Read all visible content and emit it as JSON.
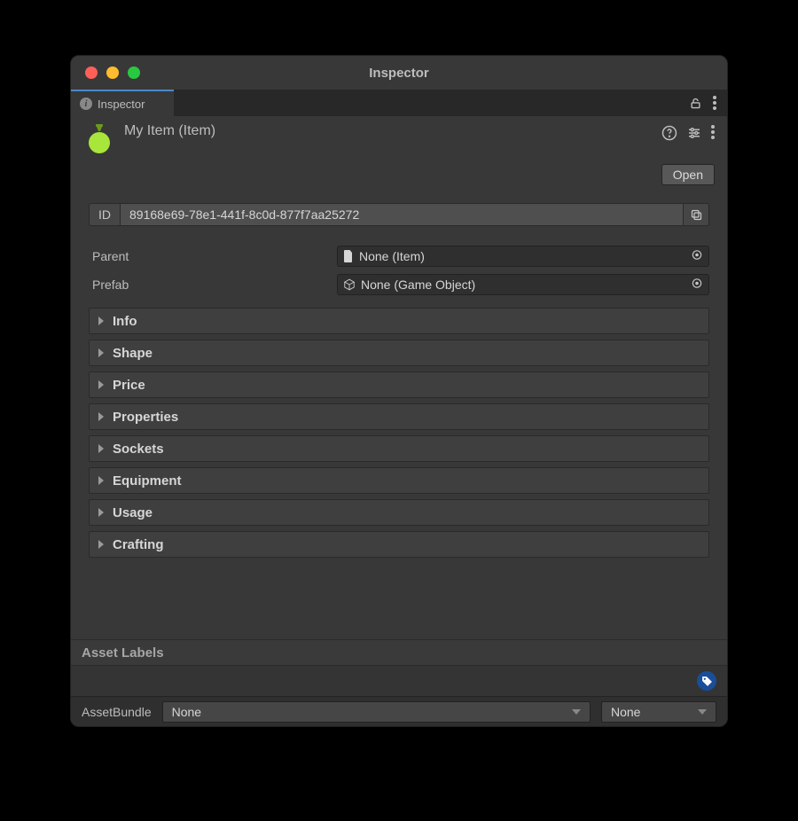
{
  "window": {
    "title": "Inspector"
  },
  "tab": {
    "label": "Inspector"
  },
  "header": {
    "name": "My Item (Item)",
    "open_label": "Open"
  },
  "fields": {
    "id_label": "ID",
    "id_value": "89168e69-78e1-441f-8c0d-877f7aa25272",
    "parent_label": "Parent",
    "parent_value": "None (Item)",
    "prefab_label": "Prefab",
    "prefab_value": "None (Game Object)"
  },
  "foldouts": [
    "Info",
    "Shape",
    "Price",
    "Properties",
    "Sockets",
    "Equipment",
    "Usage",
    "Crafting"
  ],
  "footer": {
    "labels_header": "Asset Labels",
    "bundle_label": "AssetBundle",
    "bundle_value": "None",
    "variant_value": "None"
  },
  "colors": {
    "potion": "#a8e63b"
  }
}
